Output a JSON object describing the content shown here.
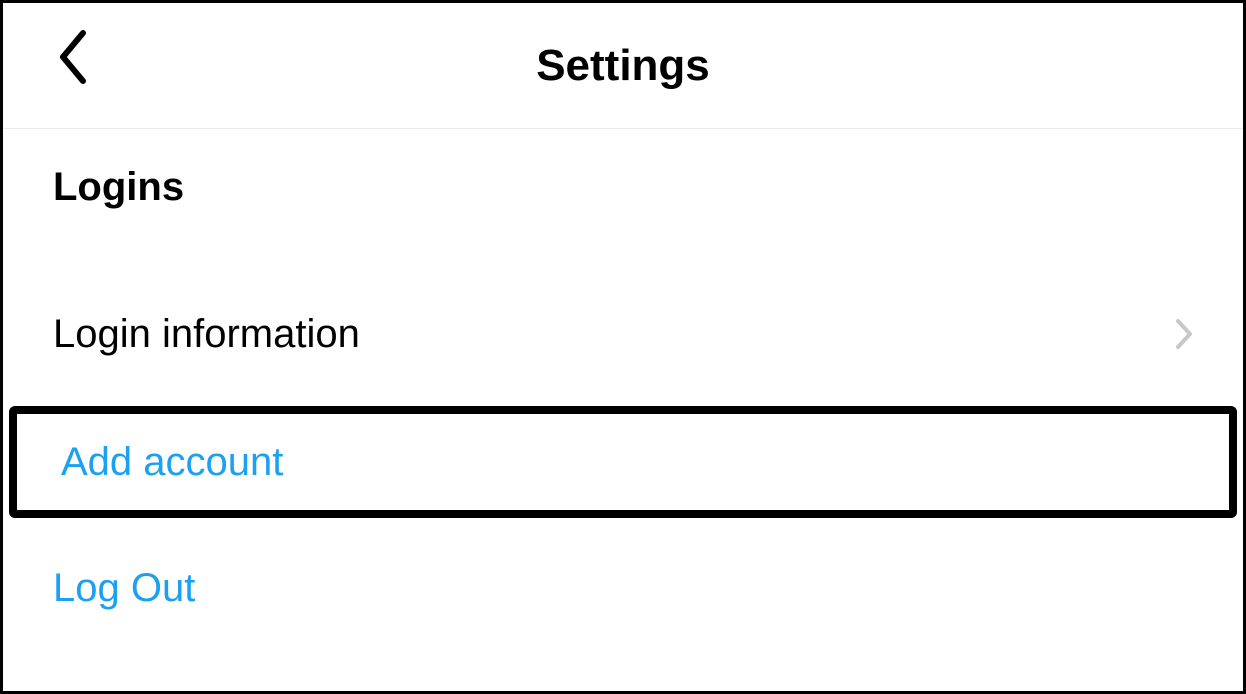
{
  "header": {
    "title": "Settings"
  },
  "section": {
    "heading": "Logins",
    "items": [
      {
        "label": "Login information",
        "has_chevron": true,
        "is_link": false,
        "highlighted": false
      },
      {
        "label": "Add account",
        "has_chevron": false,
        "is_link": true,
        "highlighted": true
      },
      {
        "label": "Log Out",
        "has_chevron": false,
        "is_link": true,
        "highlighted": false
      }
    ]
  }
}
